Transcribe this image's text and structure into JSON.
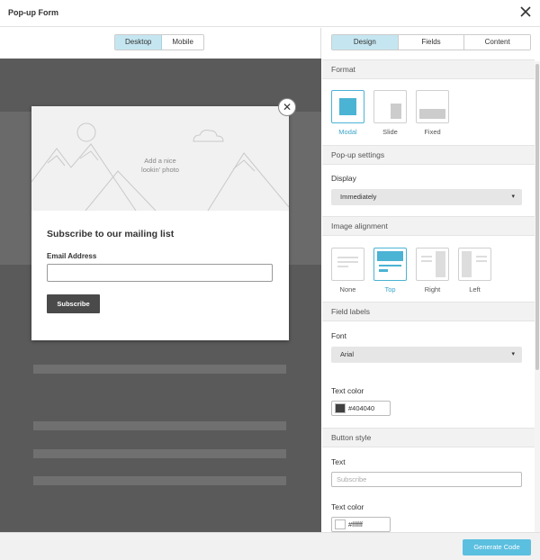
{
  "window": {
    "title": "Pop-up Form"
  },
  "preview": {
    "tabs": [
      "Desktop",
      "Mobile"
    ],
    "active_tab": "Desktop",
    "modal": {
      "image_placeholder": [
        "Add a nice",
        "lookin' photo"
      ],
      "heading": "Subscribe to our mailing list",
      "field_label": "Email Address",
      "field_value": "",
      "button_label": "Subscribe"
    }
  },
  "panel": {
    "tabs": [
      "Design",
      "Fields",
      "Content"
    ],
    "active_tab": "Design",
    "format": {
      "title": "Format",
      "options": [
        "Modal",
        "Slide",
        "Fixed"
      ],
      "selected": "Modal"
    },
    "popup_settings": {
      "title": "Pop-up settings",
      "display_label": "Display",
      "display_value": "Immediately"
    },
    "image_alignment": {
      "title": "Image alignment",
      "options": [
        "None",
        "Top",
        "Right",
        "Left"
      ],
      "selected": "Top"
    },
    "field_labels": {
      "title": "Field labels",
      "font_label": "Font",
      "font_value": "Arial",
      "text_color_label": "Text color",
      "text_color": "#404040"
    },
    "button_style": {
      "title": "Button style",
      "text_label": "Text",
      "text_placeholder": "Subscribe",
      "text_color_label": "Text color",
      "text_color": "#ffffff"
    }
  },
  "footer": {
    "generate_button": "Generate Code"
  },
  "colors": {
    "accent": "#5bbfe0",
    "selected_border": "#4bb3d4",
    "tab_active": "#c5e6f1"
  }
}
